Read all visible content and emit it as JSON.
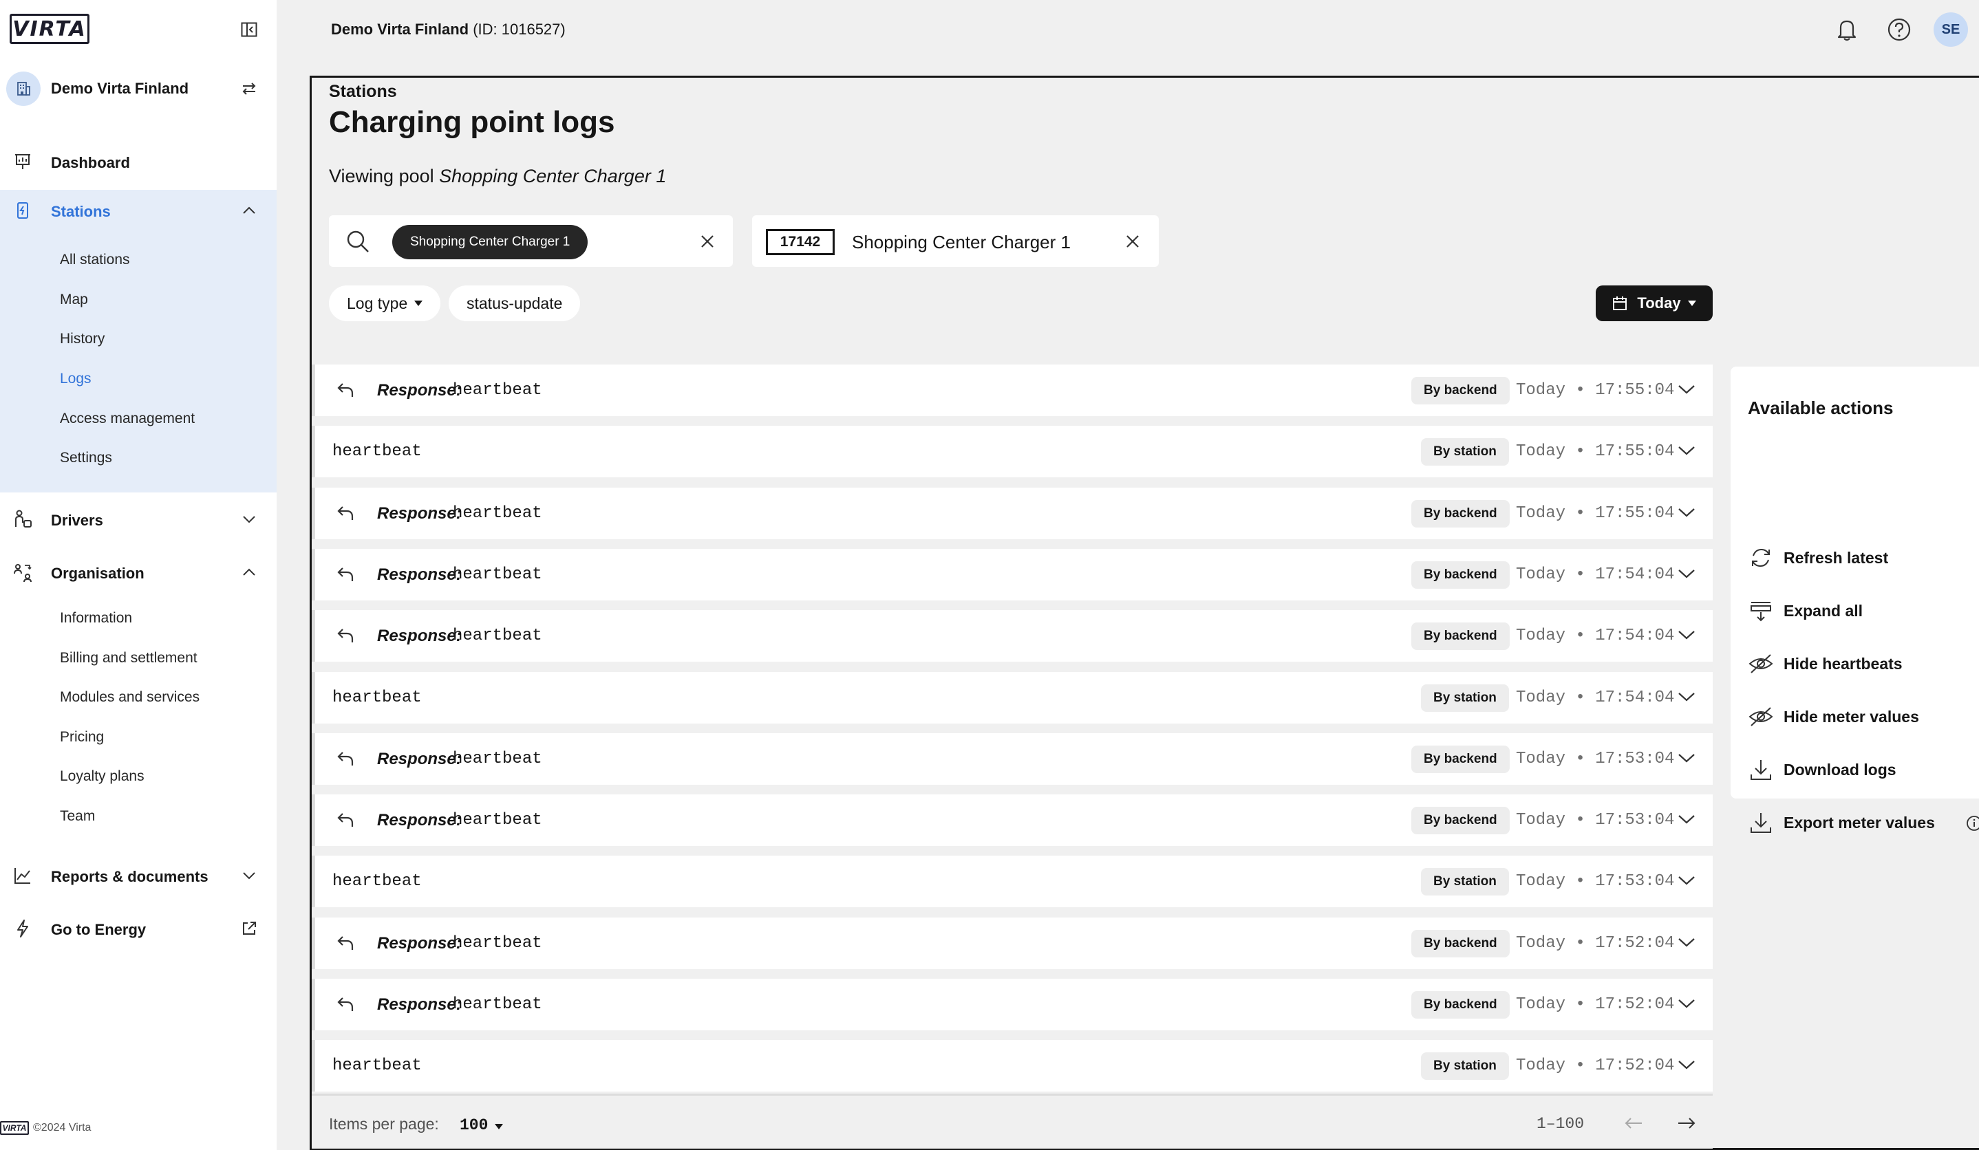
{
  "brand": {
    "logo_text": "VIRTA",
    "footer": "©2024 Virta"
  },
  "sidebar": {
    "org_name": "Demo Virta Finland",
    "dashboard": "Dashboard",
    "stations": {
      "label": "Stations",
      "items": [
        "All stations",
        "Map",
        "History",
        "Logs",
        "Access management",
        "Settings"
      ],
      "active": "Logs"
    },
    "drivers": "Drivers",
    "organisation": {
      "label": "Organisation",
      "items": [
        "Information",
        "Billing and settlement",
        "Modules and services",
        "Pricing",
        "Loyalty plans",
        "Team"
      ]
    },
    "reports": "Reports & documents",
    "energy": "Go to Energy"
  },
  "header": {
    "org_title": "Demo Virta Finland",
    "org_id": "(ID: 1016527)",
    "avatar": "SE"
  },
  "page": {
    "breadcrumb": "Stations",
    "title": "Charging point logs",
    "viewing_prefix": "Viewing pool",
    "viewing_pool": "Shopping Center Charger 1"
  },
  "filters": {
    "search_chip": "Shopping Center Charger 1",
    "station_id": "17142",
    "station_name": "Shopping Center Charger 1",
    "log_type_label": "Log type",
    "status_pill": "status-update",
    "date_label": "Today"
  },
  "logs": {
    "response_prefix": "Response:",
    "rows": [
      {
        "type": "response",
        "message": "heartbeat",
        "source": "By backend",
        "time": "Today • 17:55:04"
      },
      {
        "type": "request",
        "message": "heartbeat",
        "source": "By station",
        "time": "Today • 17:55:04"
      },
      {
        "type": "response",
        "message": "heartbeat",
        "source": "By backend",
        "time": "Today • 17:55:04"
      },
      {
        "type": "response",
        "message": "heartbeat",
        "source": "By backend",
        "time": "Today • 17:54:04"
      },
      {
        "type": "response",
        "message": "heartbeat",
        "source": "By backend",
        "time": "Today • 17:54:04"
      },
      {
        "type": "request",
        "message": "heartbeat",
        "source": "By station",
        "time": "Today • 17:54:04"
      },
      {
        "type": "response",
        "message": "heartbeat",
        "source": "By backend",
        "time": "Today • 17:53:04"
      },
      {
        "type": "response",
        "message": "heartbeat",
        "source": "By backend",
        "time": "Today • 17:53:04"
      },
      {
        "type": "request",
        "message": "heartbeat",
        "source": "By station",
        "time": "Today • 17:53:04"
      },
      {
        "type": "response",
        "message": "heartbeat",
        "source": "By backend",
        "time": "Today • 17:52:04"
      },
      {
        "type": "response",
        "message": "heartbeat",
        "source": "By backend",
        "time": "Today • 17:52:04"
      },
      {
        "type": "request",
        "message": "heartbeat",
        "source": "By station",
        "time": "Today • 17:52:04"
      }
    ]
  },
  "pagination": {
    "items_per_page_label": "Items per page:",
    "items_per_page": "100",
    "range": "1–100"
  },
  "actions": {
    "title": "Available actions",
    "items": [
      "Refresh latest",
      "Expand all",
      "Hide heartbeats",
      "Hide meter values",
      "Download logs",
      "Export meter values"
    ]
  },
  "colors": {
    "accent": "#3274d9",
    "active_bg": "#e5edf9",
    "dark": "#161616"
  }
}
